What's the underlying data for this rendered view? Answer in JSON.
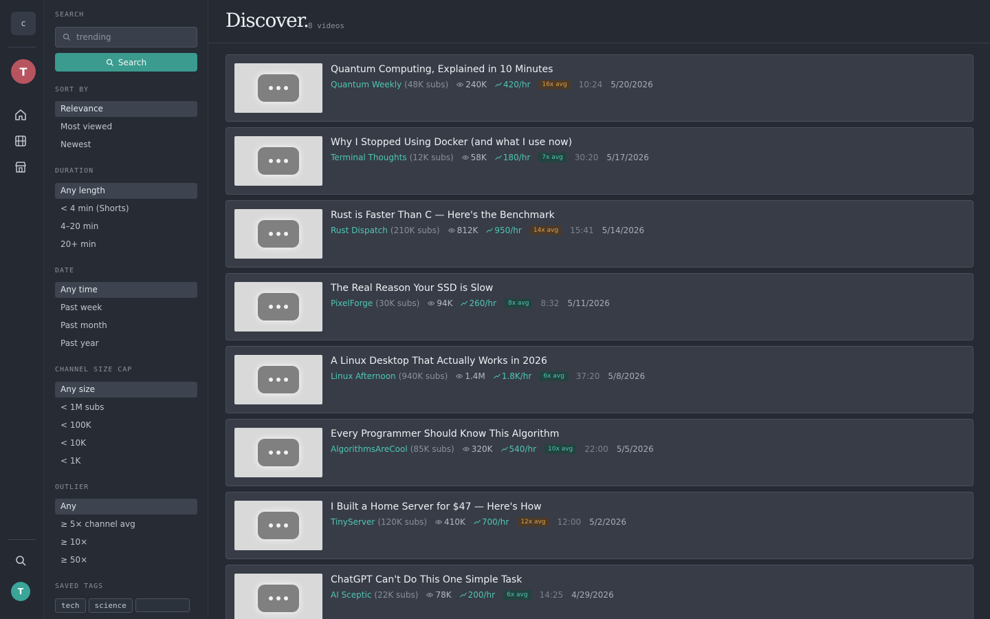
{
  "rail": {
    "logo_letter": "c",
    "user_initial": "T",
    "bottom_user_initial": "T",
    "icons": [
      "home-icon",
      "film-icon",
      "store-icon",
      "search-icon"
    ]
  },
  "filters": {
    "search_label": "SEARCH",
    "search_value": "trending",
    "search_button": "Search",
    "sort": {
      "label": "SORT BY",
      "options": [
        "Relevance",
        "Most viewed",
        "Newest"
      ],
      "selected": "Relevance"
    },
    "duration": {
      "label": "DURATION",
      "options": [
        "Any length",
        "< 4 min (Shorts)",
        "4–20 min",
        "20+ min"
      ],
      "selected": "Any length"
    },
    "date": {
      "label": "DATE",
      "options": [
        "Any time",
        "Past week",
        "Past month",
        "Past year"
      ],
      "selected": "Any time"
    },
    "channel_size": {
      "label": "CHANNEL SIZE CAP",
      "options": [
        "Any size",
        "< 1M subs",
        "< 100K",
        "< 10K",
        "< 1K"
      ],
      "selected": "Any size"
    },
    "outlier": {
      "label": "OUTLIER",
      "options": [
        "Any",
        "≥ 5× channel avg",
        "≥ 10×",
        "≥ 50×"
      ],
      "selected": "Any"
    },
    "saved_tags": {
      "label": "SAVED TAGS",
      "tags": [
        "tech",
        "science"
      ]
    }
  },
  "header": {
    "title": "Discover.",
    "count": "8 videos"
  },
  "videos": [
    {
      "title": "Quantum Computing, Explained in 10 Minutes",
      "channel": "Quantum Weekly",
      "subs": "(48K subs)",
      "views": "240K",
      "velocity": "420/hr",
      "badge": "16x avg",
      "duration": "10:24",
      "date": "5/20/2026"
    },
    {
      "title": "Why I Stopped Using Docker (and what I use now)",
      "channel": "Terminal Thoughts",
      "subs": "(12K subs)",
      "views": "58K",
      "velocity": "180/hr",
      "badge": "7x avg",
      "duration": "30:20",
      "date": "5/17/2026"
    },
    {
      "title": "Rust is Faster Than C — Here's the Benchmark",
      "channel": "Rust Dispatch",
      "subs": "(210K subs)",
      "views": "812K",
      "velocity": "950/hr",
      "badge": "14x avg",
      "duration": "15:41",
      "date": "5/14/2026"
    },
    {
      "title": "The Real Reason Your SSD is Slow",
      "channel": "PixelForge",
      "subs": "(30K subs)",
      "views": "94K",
      "velocity": "260/hr",
      "badge": "8x avg",
      "duration": "8:32",
      "date": "5/11/2026"
    },
    {
      "title": "A Linux Desktop That Actually Works in 2026",
      "channel": "Linux Afternoon",
      "subs": "(940K subs)",
      "views": "1.4M",
      "velocity": "1.8K/hr",
      "badge": "6x avg",
      "duration": "37:20",
      "date": "5/8/2026"
    },
    {
      "title": "Every Programmer Should Know This Algorithm",
      "channel": "AlgorithmsAreCool",
      "subs": "(85K subs)",
      "views": "320K",
      "velocity": "540/hr",
      "badge": "10x avg",
      "duration": "22:00",
      "date": "5/5/2026"
    },
    {
      "title": "I Built a Home Server for $47 — Here's How",
      "channel": "TinyServer",
      "subs": "(120K subs)",
      "views": "410K",
      "velocity": "700/hr",
      "badge": "12x avg",
      "duration": "12:00",
      "date": "5/2/2026"
    },
    {
      "title": "ChatGPT Can't Do This One Simple Task",
      "channel": "AI Sceptic",
      "subs": "(22K subs)",
      "views": "78K",
      "velocity": "200/hr",
      "badge": "6x avg",
      "duration": "14:25",
      "date": "4/29/2026"
    }
  ],
  "colors": {
    "accent": "#4fc6b4",
    "button": "#3a9b8e",
    "hot_badge": "#e0a043",
    "avatar_top": "#b8545f",
    "avatar_bottom": "#3aa598"
  }
}
